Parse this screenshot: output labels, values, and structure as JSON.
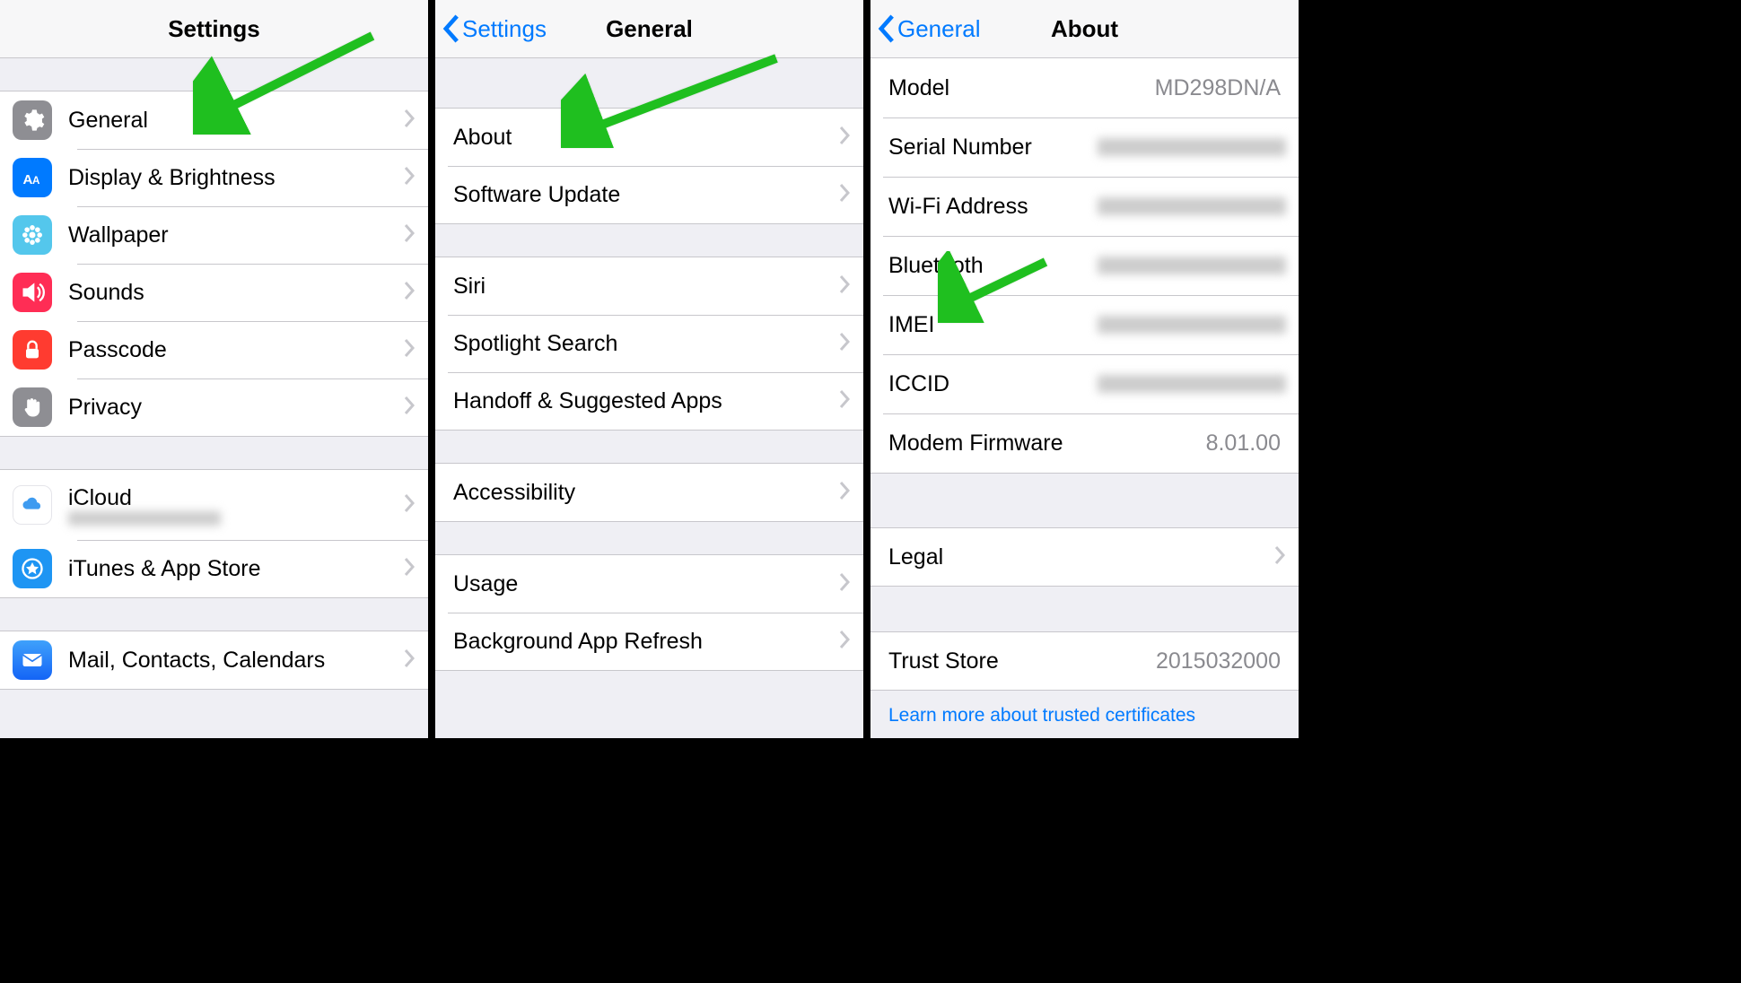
{
  "screen1": {
    "title": "Settings",
    "group1": [
      {
        "key": "general",
        "label": "General",
        "icon": "gear",
        "color": "#8e8e93"
      },
      {
        "key": "display",
        "label": "Display & Brightness",
        "icon": "aa",
        "color": "#007aff"
      },
      {
        "key": "wallpaper",
        "label": "Wallpaper",
        "icon": "flower",
        "color": "#54c7ec"
      },
      {
        "key": "sounds",
        "label": "Sounds",
        "icon": "speaker",
        "color": "#ff2d55"
      },
      {
        "key": "passcode",
        "label": "Passcode",
        "icon": "lock",
        "color": "#ff3b30"
      },
      {
        "key": "privacy",
        "label": "Privacy",
        "icon": "hand",
        "color": "#8e8e93"
      }
    ],
    "group2": [
      {
        "key": "icloud",
        "label": "iCloud",
        "sub": "",
        "icon": "cloud",
        "color": "#ffffff",
        "iconfg": "#3e9bf0"
      },
      {
        "key": "itunes",
        "label": "iTunes & App Store",
        "icon": "appstore",
        "color": "#1e95f3"
      }
    ],
    "group3": [
      {
        "key": "mail",
        "label": "Mail, Contacts, Calendars",
        "icon": "mail",
        "color": "#1f7cf6"
      }
    ]
  },
  "screen2": {
    "back": "Settings",
    "title": "General",
    "group1": [
      {
        "key": "about",
        "label": "About"
      },
      {
        "key": "swupdate",
        "label": "Software Update"
      }
    ],
    "group2": [
      {
        "key": "siri",
        "label": "Siri"
      },
      {
        "key": "spotlight",
        "label": "Spotlight Search"
      },
      {
        "key": "handoff",
        "label": "Handoff & Suggested Apps"
      }
    ],
    "group3": [
      {
        "key": "accessibility",
        "label": "Accessibility"
      }
    ],
    "group4": [
      {
        "key": "usage",
        "label": "Usage"
      },
      {
        "key": "bgrefresh",
        "label": "Background App Refresh"
      }
    ]
  },
  "screen3": {
    "back": "General",
    "title": "About",
    "rows": [
      {
        "key": "model",
        "label": "Model",
        "value": "MD298DN/A"
      },
      {
        "key": "serial",
        "label": "Serial Number",
        "value": "blur"
      },
      {
        "key": "wifi",
        "label": "Wi-Fi Address",
        "value": "blur"
      },
      {
        "key": "bluetooth",
        "label": "Bluetooth",
        "value": "blur"
      },
      {
        "key": "imei",
        "label": "IMEI",
        "value": "blur"
      },
      {
        "key": "iccid",
        "label": "ICCID",
        "value": "blur"
      },
      {
        "key": "modem",
        "label": "Modem Firmware",
        "value": "8.01.00"
      }
    ],
    "legal": {
      "label": "Legal"
    },
    "trust": {
      "label": "Trust Store",
      "value": "2015032000"
    },
    "footer_link": "Learn more about trusted certificates"
  },
  "colors": {
    "green": "#2fd02f"
  }
}
